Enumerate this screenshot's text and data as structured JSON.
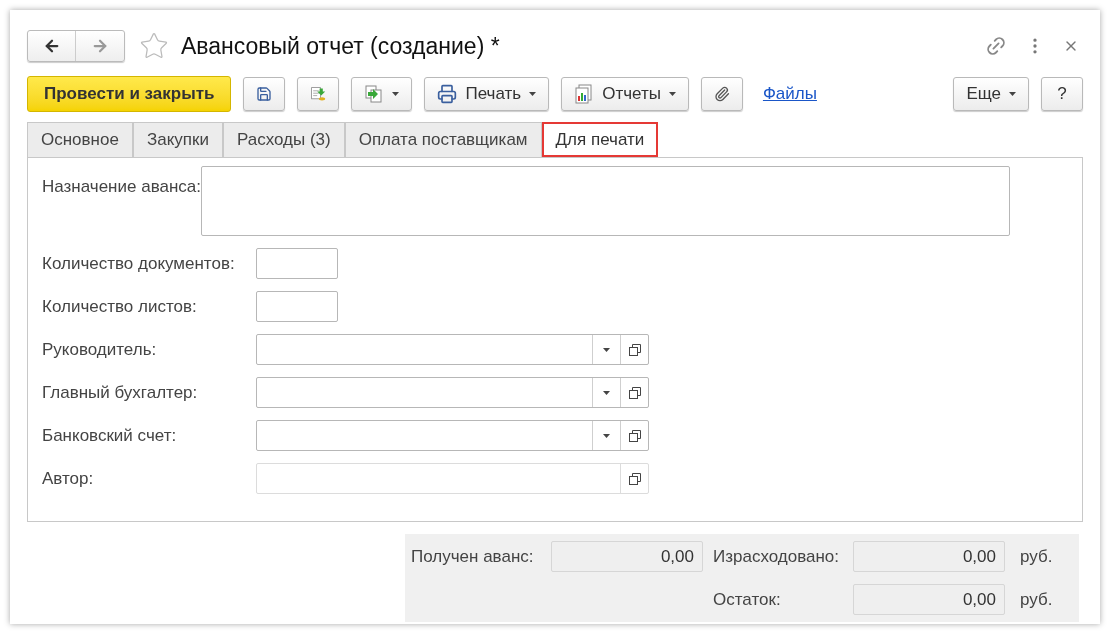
{
  "window": {
    "title": "Авансовый отчет (создание) *",
    "favorite": false
  },
  "toolbar": [
    {
      "kind": "primary",
      "label": "Провести и закрыть"
    },
    {
      "kind": "save"
    },
    {
      "kind": "post"
    },
    {
      "kind": "create"
    },
    {
      "kind": "print",
      "label": "Печать"
    },
    {
      "kind": "reports",
      "label": "Отчеты"
    },
    {
      "kind": "attach"
    },
    {
      "kind": "link",
      "label": "Файлы"
    }
  ],
  "toolbar_right": [
    {
      "kind": "more",
      "label": "Еще"
    },
    {
      "kind": "help",
      "label": "?"
    }
  ],
  "tabs": [
    {
      "label": "Основное",
      "selected": false
    },
    {
      "label": "Закупки",
      "selected": false
    },
    {
      "label": "Расходы (3)",
      "selected": false
    },
    {
      "label": "Оплата поставщикам",
      "selected": false
    },
    {
      "label": "Для печати",
      "selected": true
    }
  ],
  "fields": [
    {
      "kind": "textarea",
      "label": "Назначение аванса:"
    },
    {
      "kind": "short",
      "label": "Количество документов:"
    },
    {
      "kind": "short",
      "label": "Количество листов:"
    },
    {
      "kind": "select",
      "label": "Руководитель:"
    },
    {
      "kind": "select",
      "label": "Главный бухгалтер:"
    },
    {
      "kind": "select",
      "label": "Банковский счет:"
    },
    {
      "kind": "open",
      "label": "Автор:"
    }
  ],
  "totals": {
    "received": {
      "label": "Получен аванс:",
      "value": "0,00"
    },
    "spent": {
      "label": "Израсходовано:",
      "value": "0,00",
      "unit": "руб."
    },
    "balance": {
      "label": "Остаток:",
      "value": "0,00",
      "unit": "руб."
    }
  }
}
